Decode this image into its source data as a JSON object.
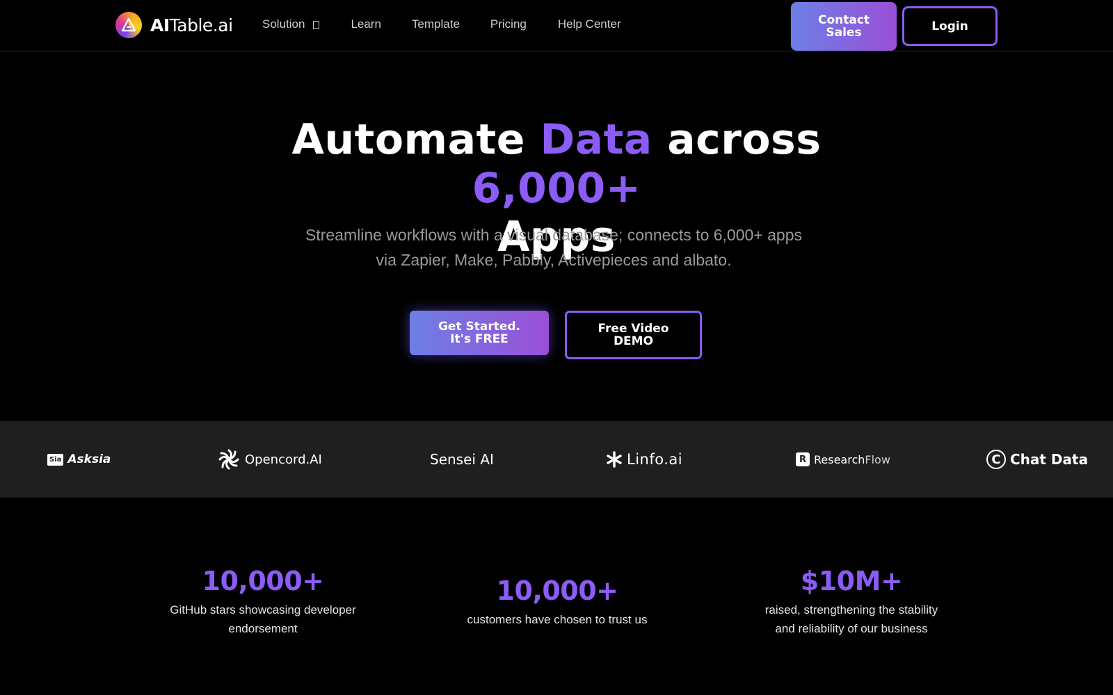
{
  "brand": {
    "name_prefix": "AI",
    "name_suffix": "Table.ai"
  },
  "nav": {
    "items": [
      {
        "label": "Solution"
      },
      {
        "label": "Learn"
      },
      {
        "label": "Template"
      },
      {
        "label": "Pricing"
      },
      {
        "label": "Help Center"
      }
    ],
    "contact_line1": "Contact",
    "contact_line2": "Sales",
    "login": "Login"
  },
  "hero": {
    "title_word1": "Automate",
    "title_word2": "Data",
    "title_word3": "across",
    "title_word4": "6,000+",
    "title_word5": "Apps",
    "subtitle_line1": "Streamline workflows with a visual database; connects to 6,000+ apps",
    "subtitle_line2": "via Zapier, Make, Pabbly, Activepieces and albato.",
    "cta_primary_line1": "Get Started.",
    "cta_primary_line2": "It's FREE",
    "cta_secondary_line1": "Free Video",
    "cta_secondary_line2": "DEMO"
  },
  "partners": {
    "asksia_badge": "Sia",
    "asksia": "Asksia",
    "opencord": "Opencord.AI",
    "sensei": "Sensei AI",
    "linfo": "Linfo.ai",
    "research_icon": "R",
    "research_a": "Research",
    "research_b": "Flow",
    "chat": "Chat Data"
  },
  "stats": [
    {
      "value": "10,000+",
      "label_line1": "GitHub stars showcasing developer",
      "label_line2": "endorsement"
    },
    {
      "value": "10,000+",
      "label_line1": "customers have chosen to trust us"
    },
    {
      "value": "$10M+",
      "label_line1": "raised, strengthening the stability",
      "label_line2": "and reliability of our business"
    }
  ],
  "colors": {
    "accent": "#8b5cf6",
    "background": "#000000",
    "strip": "#1f1f1f",
    "muted_text": "#9a9a9a"
  },
  "icons": [
    "aitable-logo-icon",
    "chevron-down-icon",
    "opencord-logo-icon",
    "linfo-star-icon",
    "copyright-icon"
  ]
}
